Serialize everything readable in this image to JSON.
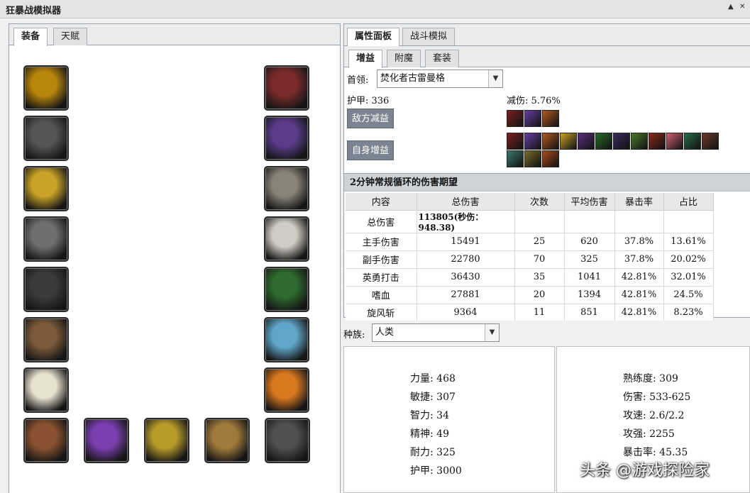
{
  "window": {
    "title": "狂暴战模拟器",
    "minimize_glyph": "▲",
    "close_glyph": "✕"
  },
  "left_tabs": [
    "装备",
    "天赋"
  ],
  "equipment": {
    "left_column": [
      "head-helm-icon",
      "neck-spiked-icon",
      "shoulder-gold-icon",
      "back-cloak-icon",
      "chest-chain-icon",
      "wrist-leather-icon",
      "tabard-white-icon"
    ],
    "right_column": [
      "hands-gauntlet-icon",
      "waist-purple-icon",
      "legs-plate-icon",
      "feet-boots-icon",
      "finger-green-ring-icon",
      "finger-silver-ring-icon",
      "trinket-red-icon"
    ],
    "bottom_row": [
      "shirt-copper-icon",
      "main-hand-purple-sword-icon",
      "off-hand-gold-sword-icon",
      "ranged-bow-icon",
      "trinket-studded-icon"
    ]
  },
  "right_tabs": [
    "属性面板",
    "战斗模拟"
  ],
  "sub_tabs": [
    "增益",
    "附魔",
    "套装"
  ],
  "boss": {
    "label": "首领:",
    "value": "焚化者古雷曼格"
  },
  "armor": "护甲: 336",
  "damage_reduction": "减伤: 5.76%",
  "debuff_button": "敌方减益",
  "buff_button": "自身增益",
  "debuff_icons": [
    "sunder-icon",
    "curse-icon",
    "faerie-icon"
  ],
  "buff_icons": [
    "kings-icon",
    "might-icon",
    "fortitude-icon",
    "leaf-icon",
    "potion-icon",
    "herb-icon",
    "dragon-icon",
    "burst-icon",
    "totem-icon",
    "arrow-icon",
    "wind-icon",
    "claw-icon",
    "sword-icon",
    "horn-icon",
    "flame-icon"
  ],
  "colors": {
    "helm": "#b8860b",
    "neck": "#555555",
    "shoulder": "#c9a227",
    "back": "#6f6f6f",
    "chest": "#3b3b3b",
    "wrist": "#7a5a3a",
    "tabard": "#e8e2d0",
    "hands": "#7a2a2a",
    "waist": "#5a3c8a",
    "legs": "#8a8478",
    "feet": "#d0ccc4",
    "ring1": "#2e6b2e",
    "ring2": "#5fa6c9",
    "trinket": "#d9781e",
    "shirt": "#8a5230",
    "mainhand": "#7b3fb0",
    "offhand": "#b79b2a",
    "ranged": "#a07a3a",
    "studded": "#505050"
  },
  "damage_panel": {
    "title": "2分钟常规循环的伤害期望",
    "columns": [
      "内容",
      "总伤害",
      "次数",
      "平均伤害",
      "暴击率",
      "占比"
    ],
    "total_row": {
      "name": "总伤害",
      "value": "113805(秒伤：948.38)"
    },
    "rows": [
      [
        "主手伤害",
        "15491",
        "25",
        "620",
        "37.8%",
        "13.61%"
      ],
      [
        "副手伤害",
        "22780",
        "70",
        "325",
        "37.8%",
        "20.02%"
      ],
      [
        "英勇打击",
        "36430",
        "35",
        "1041",
        "42.81%",
        "32.01%"
      ],
      [
        "嗜血",
        "27881",
        "20",
        "1394",
        "42.81%",
        "24.5%"
      ],
      [
        "旋风斩",
        "9364",
        "11",
        "851",
        "42.81%",
        "8.23%"
      ]
    ]
  },
  "race": {
    "label": "种族:",
    "value": "人类"
  },
  "stats_left": [
    "力量: 468",
    "敏捷: 307",
    "智力: 34",
    "精神: 49",
    "耐力: 325",
    "护甲: 3000"
  ],
  "stats_right": [
    "熟练度: 309",
    "伤害: 533-625",
    "攻速: 2.6/2.2",
    "攻强: 2255",
    "暴击率: 45.35"
  ],
  "watermark": "头条 @游戏探险家"
}
